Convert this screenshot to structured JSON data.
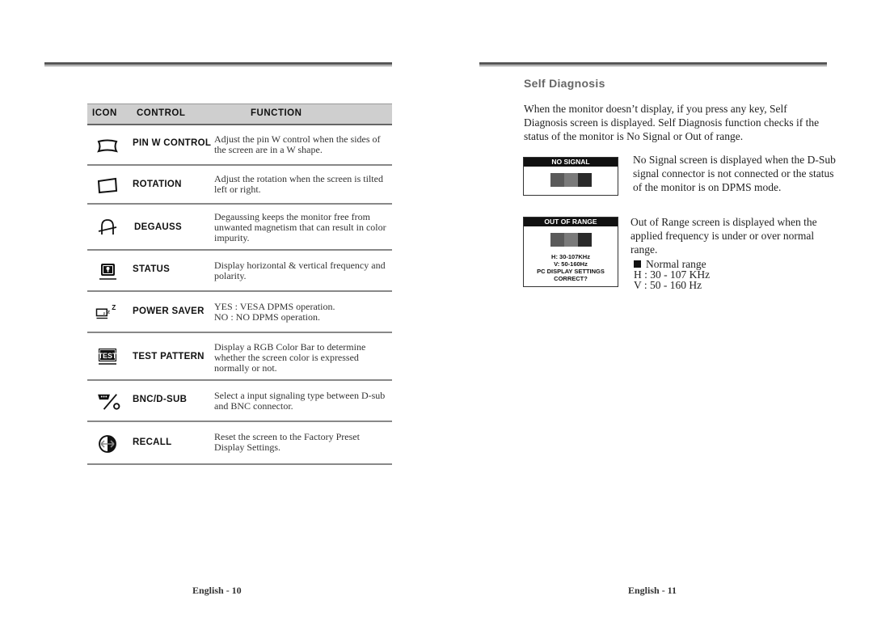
{
  "left_page": {
    "table": {
      "headers": {
        "icon": "ICON",
        "control": "CONTROL",
        "function": "FUNCTION"
      },
      "rows": [
        {
          "icon": "pin-w-icon",
          "control": "PIN W CONTROL",
          "function": "Adjust the pin W control when the sides of the screen are in a W shape."
        },
        {
          "icon": "rotation-icon",
          "control": "ROTATION",
          "function": "Adjust the rotation when the screen is tilted left or right."
        },
        {
          "icon": "degauss-icon",
          "control": "DEGAUSS",
          "function": "Degaussing keeps the monitor free from unwanted magnetism that can result in color impurity."
        },
        {
          "icon": "status-icon",
          "control": "STATUS",
          "function": "Display horizontal & vertical frequency and polarity."
        },
        {
          "icon": "power-saver-icon",
          "control": "POWER SAVER",
          "function_lines": [
            "YES : VESA DPMS operation.",
            "NO : NO DPMS operation."
          ]
        },
        {
          "icon": "test-pattern-icon",
          "control": "TEST PATTERN",
          "function": "Display a RGB Color Bar to determine whether the screen color is expressed normally or not."
        },
        {
          "icon": "bnc-dsub-icon",
          "control": "BNC/D-SUB",
          "function": "Select a input signaling type between D-sub and BNC connector."
        },
        {
          "icon": "recall-icon",
          "control": "RECALL",
          "function": "Reset the screen to the Factory Preset Display Settings."
        }
      ]
    },
    "footer": "English - 10"
  },
  "right_page": {
    "title": "Self Diagnosis",
    "intro": "When the monitor doesn’t  display, if you press any key, Self Diagnosis screen is displayed.  Self Diagnosis function checks if the status of the monitor is No Signal or Out of range.",
    "no_signal_screen": {
      "title": "NO SIGNAL",
      "description": "No Signal screen is displayed when the D-Sub signal connector is not connected or the status of the monitor is on DPMS mode."
    },
    "out_of_range_screen": {
      "title": "OUT OF RANGE",
      "lines": [
        "H: 30-107KHz",
        "V: 50-160Hz",
        "PC DISPLAY SETTINGS",
        "CORRECT?"
      ],
      "description": "Out of Range screen is displayed when the applied frequency is under or over normal range."
    },
    "swatch_colors": [
      "#5a5a5a",
      "#7a7a7a",
      "#2a2a2a"
    ],
    "normal_range": {
      "label": "Normal range",
      "h": "H : 30 - 107 KHz",
      "v": "V : 50 - 160 Hz"
    },
    "footer": "English - 11"
  }
}
